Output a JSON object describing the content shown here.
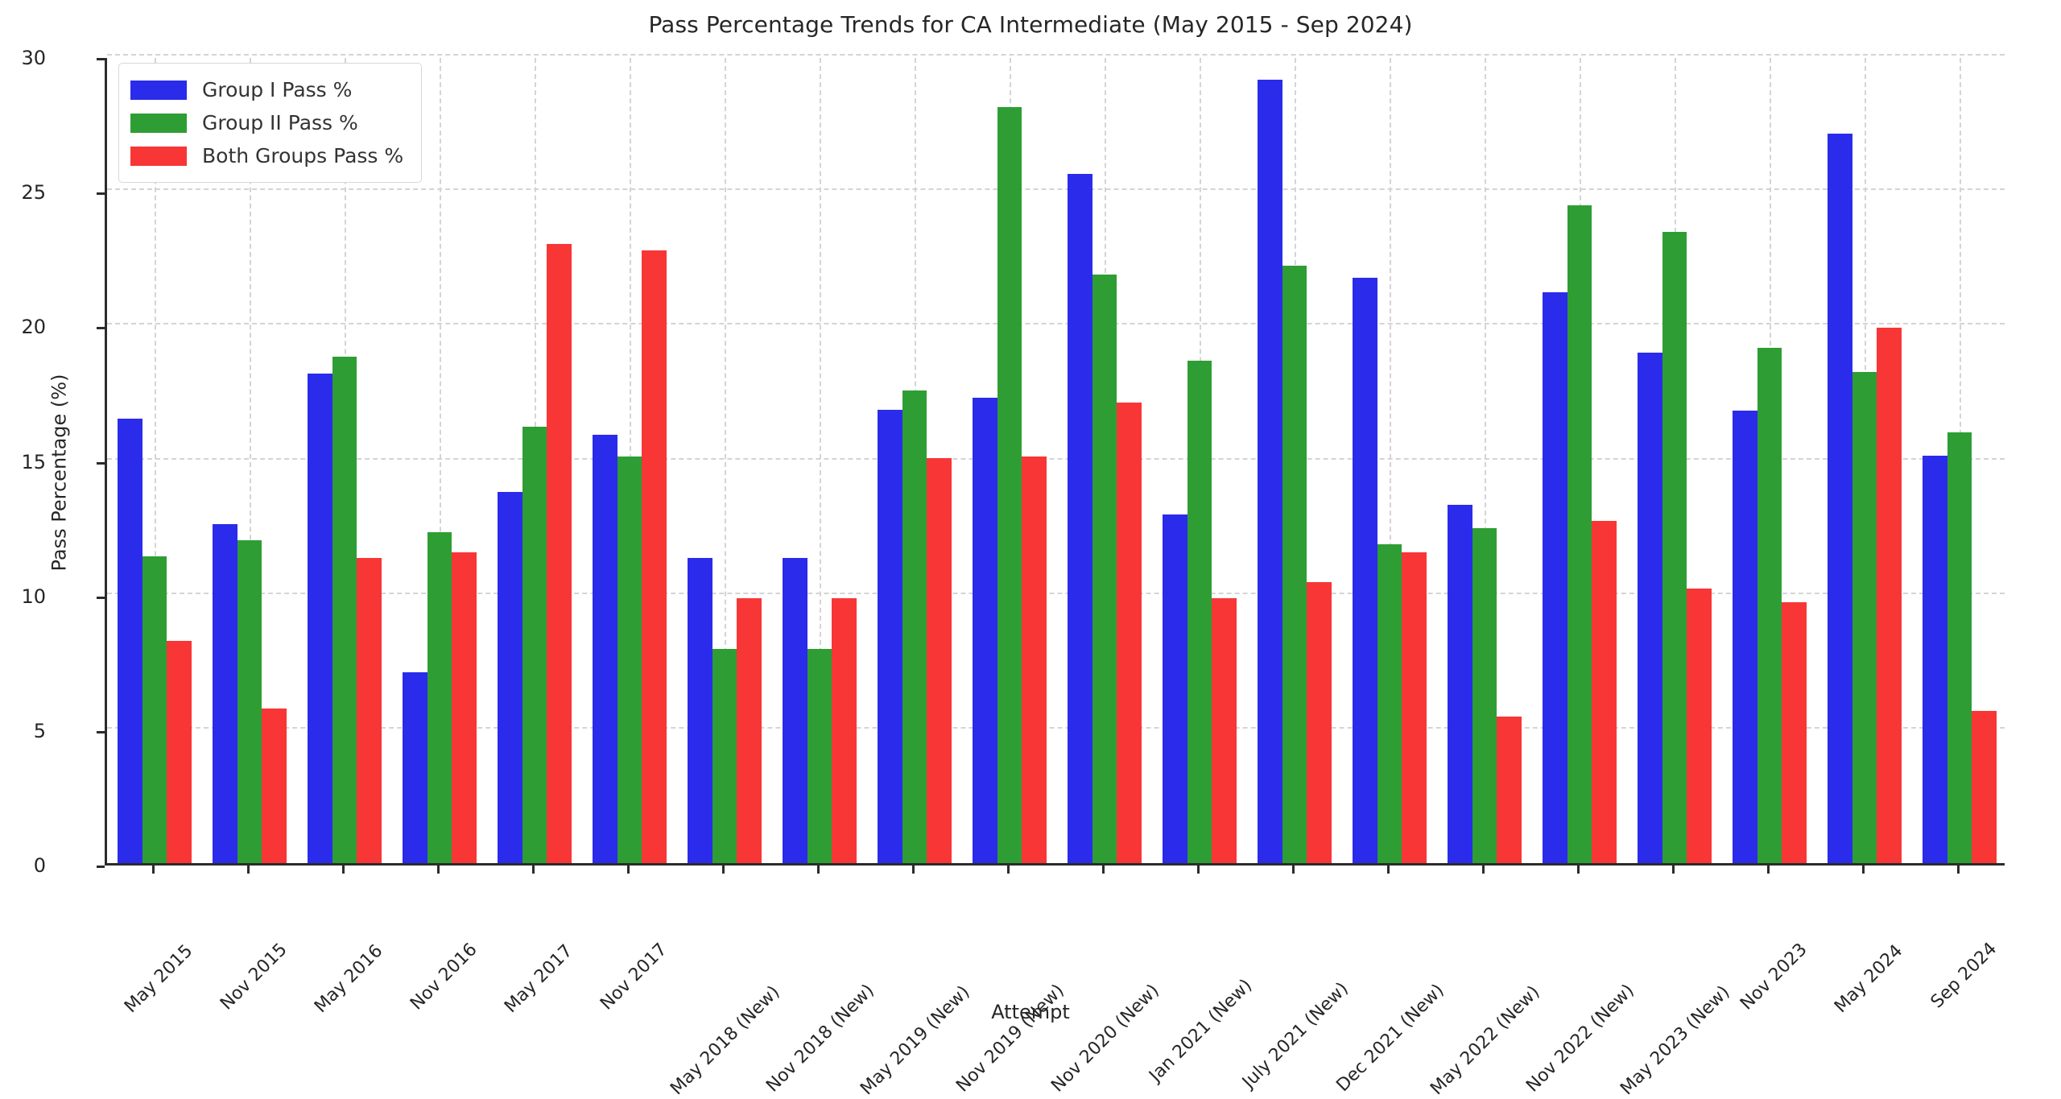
{
  "chart_data": {
    "type": "bar",
    "title": "Pass Percentage Trends for CA Intermediate (May 2015 - Sep 2024)",
    "xlabel": "Attempt",
    "ylabel": "Pass Percentage (%)",
    "ylim": [
      0,
      30
    ],
    "yticks": [
      0,
      5,
      10,
      15,
      20,
      25,
      30
    ],
    "grid": true,
    "legend_position": "upper left",
    "categories": [
      "May 2015",
      "Nov 2015",
      "May 2016",
      "Nov 2016",
      "May 2017",
      "Nov 2017",
      "May 2018 (New)",
      "Nov 2018 (New)",
      "May 2019 (New)",
      "Nov 2019 (New)",
      "Nov 2020 (New)",
      "Jan 2021 (New)",
      "July 2021 (New)",
      "Dec 2021 (New)",
      "May 2022 (New)",
      "Nov 2022 (New)",
      "May 2023 (New)",
      "Nov 2023",
      "May 2024",
      "Sep 2024"
    ],
    "series": [
      {
        "name": "Group I Pass %",
        "color": "#2b2beb",
        "values": [
          16.5,
          12.6,
          18.2,
          7.1,
          13.8,
          15.9,
          11.35,
          11.35,
          16.85,
          17.3,
          25.6,
          12.95,
          29.1,
          21.75,
          13.3,
          21.2,
          18.95,
          16.8,
          27.1,
          15.15
        ]
      },
      {
        "name": "Group II Pass %",
        "color": "#2e9e34",
        "values": [
          11.4,
          12.0,
          18.8,
          12.3,
          16.2,
          15.1,
          7.95,
          7.95,
          17.55,
          28.1,
          21.85,
          18.65,
          22.2,
          11.85,
          12.45,
          24.45,
          23.45,
          19.15,
          18.25,
          16.0
        ]
      },
      {
        "name": "Both Groups Pass %",
        "color": "#f83636",
        "values": [
          8.25,
          5.75,
          11.35,
          11.55,
          23.0,
          22.75,
          9.85,
          9.85,
          15.05,
          15.1,
          17.1,
          9.85,
          10.45,
          11.55,
          5.45,
          12.7,
          10.2,
          9.7,
          19.9,
          5.65
        ]
      }
    ]
  },
  "legend": {
    "items": [
      {
        "label": "Group I Pass %"
      },
      {
        "label": "Group II Pass %"
      },
      {
        "label": "Both Groups Pass %"
      }
    ]
  }
}
